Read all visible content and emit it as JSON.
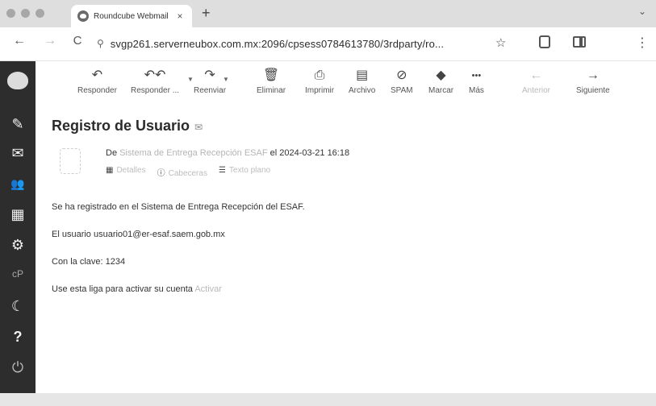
{
  "browser": {
    "tab_title": "Roundcube Webmail :: Regis",
    "tab_close": "×",
    "new_tab": "+",
    "back": "←",
    "forward": "→",
    "reload": "C",
    "url": "svgp261.serverneubox.com.mx:2096/cpsess0784613780/3rdparty/ro...",
    "star": "☆",
    "menu": "⋮",
    "tab_menu": "⌄"
  },
  "sidebar": {
    "items": [
      {
        "icon": "compose-icon",
        "glyph": "✎"
      },
      {
        "icon": "mail-icon",
        "glyph": "✉"
      },
      {
        "icon": "contacts-icon",
        "glyph": "👥"
      },
      {
        "icon": "calendar-icon",
        "glyph": "▦"
      },
      {
        "icon": "settings-icon",
        "glyph": "⚙"
      },
      {
        "icon": "cpanel-icon",
        "glyph": "cP"
      },
      {
        "icon": "dark-mode-icon",
        "glyph": "☾"
      },
      {
        "icon": "help-icon",
        "glyph": "?"
      },
      {
        "icon": "logout-icon",
        "glyph": "⏻"
      }
    ]
  },
  "toolbar": {
    "reply": {
      "label": "Responder",
      "glyph": "↶"
    },
    "reply_all": {
      "label": "Responder ...",
      "glyph": "↶↶"
    },
    "forward": {
      "label": "Reenviar",
      "glyph": "↷"
    },
    "delete": {
      "label": "Eliminar",
      "glyph": "🗑"
    },
    "print": {
      "label": "Imprimir",
      "glyph": "⎙"
    },
    "archive": {
      "label": "Archivo",
      "glyph": "▤"
    },
    "spam": {
      "label": "SPAM",
      "glyph": "⊘"
    },
    "mark": {
      "label": "Marcar",
      "glyph": "◆"
    },
    "more": {
      "label": "Más",
      "glyph": "•••"
    },
    "previous": {
      "label": "Anterior",
      "glyph": "←"
    },
    "next": {
      "label": "Siguiente",
      "glyph": "→"
    }
  },
  "message": {
    "subject": "Registro de Usuario",
    "subject_icon": "✉",
    "from_prefix": "De",
    "from_name": "Sistema de Entrega Recepción ESAF",
    "date_text": "el 2024-03-21 16:18",
    "links": {
      "details": "Detalles",
      "headers": "Cabeceras",
      "plain_text": "Texto plano"
    },
    "body": {
      "line1": "Se ha registrado en el Sistema de Entrega Recepción del ESAF.",
      "line2": "El usuario usuario01@er-esaf.saem.gob.mx",
      "line3": "Con la clave: 1234",
      "line4": "Use esta liga para activar su cuenta",
      "activate": "Activar"
    }
  }
}
